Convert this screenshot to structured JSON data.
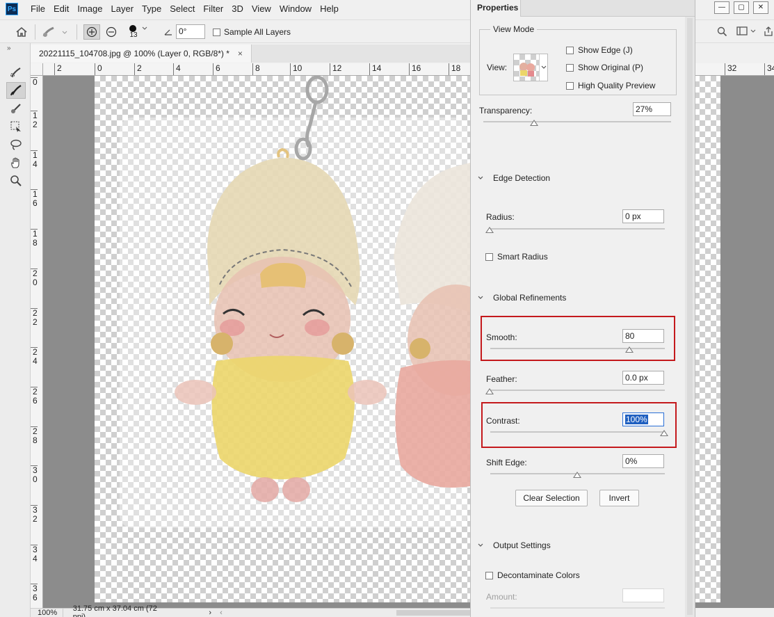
{
  "app": {
    "logo": "Ps"
  },
  "menu": [
    "File",
    "Edit",
    "Image",
    "Layer",
    "Type",
    "Select",
    "Filter",
    "3D",
    "View",
    "Window",
    "Help"
  ],
  "window_controls": {
    "minimize": "—",
    "restore": "▢",
    "close": "✕"
  },
  "options_bar": {
    "brush_size": "13",
    "angle": "0°",
    "sample_all_layers": "Sample All Layers"
  },
  "document": {
    "tab_title": "20221115_104708.jpg @ 100% (Layer 0, RGB/8*) *",
    "close": "×"
  },
  "ruler": {
    "h_labels": [
      "2",
      "0",
      "2",
      "4",
      "6",
      "8",
      "10",
      "12",
      "14",
      "16",
      "18"
    ],
    "h_right_labels": [
      "32",
      "34"
    ],
    "v_labels": [
      "0",
      "1 2",
      "1 4",
      "1 6",
      "1 8",
      "2 0",
      "2 2",
      "2 4",
      "2 6",
      "2 8",
      "3 0",
      "3 2",
      "3 4",
      "3 6"
    ]
  },
  "status": {
    "zoom": "100%",
    "dimensions": "31.75 cm x 37.04 cm (72 ppi)"
  },
  "properties": {
    "tab": "Properties",
    "view_mode": {
      "title": "View Mode",
      "view_label": "View:",
      "show_edge": "Show Edge (J)",
      "show_original": "Show Original (P)",
      "high_quality_preview": "High Quality Preview"
    },
    "transparency": {
      "label": "Transparency:",
      "value": "27%",
      "fraction": 0.27
    },
    "edge_detection": {
      "title": "Edge Detection",
      "radius_label": "Radius:",
      "radius_value": "0 px",
      "smart_radius": "Smart Radius"
    },
    "global_refinements": {
      "title": "Global Refinements",
      "smooth_label": "Smooth:",
      "smooth_value": "80",
      "feather_label": "Feather:",
      "feather_value": "0.0 px",
      "contrast_label": "Contrast:",
      "contrast_value": "100%",
      "shift_edge_label": "Shift Edge:",
      "shift_edge_value": "0%"
    },
    "buttons": {
      "clear_selection": "Clear Selection",
      "invert": "Invert"
    },
    "output_settings": {
      "title": "Output Settings",
      "decontaminate": "Decontaminate Colors",
      "amount_label": "Amount:"
    }
  }
}
